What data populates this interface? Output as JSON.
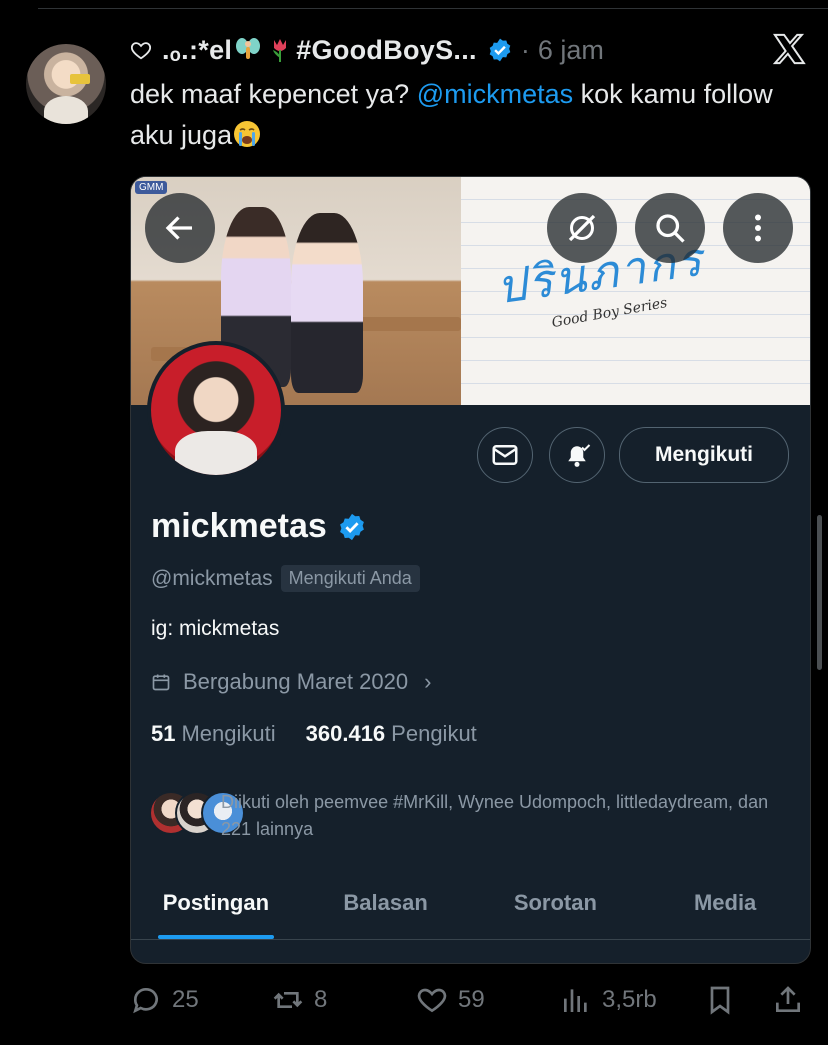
{
  "tweet": {
    "author_name": ".ₒ.:*el",
    "author_name_tail": "#GoodBoyS...",
    "time_separator": "·",
    "time": "6 jam",
    "text_before": "dek maaf kepencet ya? ",
    "mention": "@mickmetas",
    "text_after": " kok kamu follow aku juga",
    "icons": [
      "heart-outline-icon",
      "fairy-emoji",
      "tulip-emoji",
      "verified-badge-icon",
      "x-logo-icon",
      "sob-emoji"
    ]
  },
  "profile_card": {
    "display_name": "mickmetas",
    "handle": "@mickmetas",
    "follows_you": "Mengikuti Anda",
    "bio": "ig: mickmetas",
    "joined": "Bergabung Maret 2020",
    "following_count": "51",
    "following_label": "Mengikuti",
    "followers_count": "360.416",
    "followers_label": "Pengikut",
    "followed_by": "Diikuti oleh peemvee #MrKill, Wynee Udompoch, littledaydream, dan 221 lainnya",
    "follow_button": "Mengikuti",
    "banner_title": "ปรินภากร",
    "banner_subtitle": "Good Boy Series",
    "banner_logo": "GMM",
    "tabs": [
      "Postingan",
      "Balasan",
      "Sorotan",
      "Media"
    ],
    "active_tab": "Postingan"
  },
  "actions": {
    "replies": "25",
    "retweets": "8",
    "likes": "59",
    "views": "3,5rb"
  },
  "colors": {
    "accent": "#1d9bf0",
    "card_bg": "#15202b",
    "muted": "#71767b"
  }
}
